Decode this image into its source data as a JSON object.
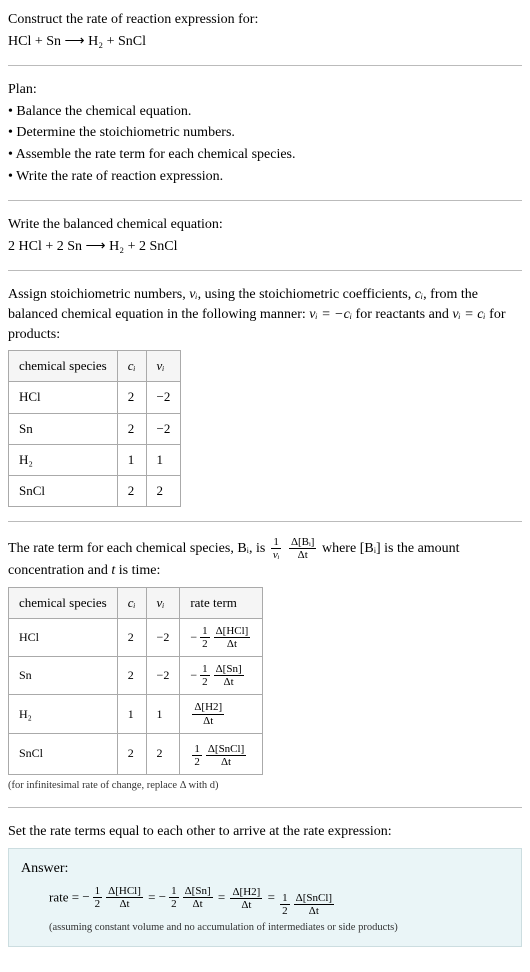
{
  "prompt": {
    "line1": "Construct the rate of reaction expression for:",
    "equation": "HCl + Sn ⟶ H₂ + SnCl"
  },
  "plan": {
    "heading": "Plan:",
    "items": [
      "• Balance the chemical equation.",
      "• Determine the stoichiometric numbers.",
      "• Assemble the rate term for each chemical species.",
      "• Write the rate of reaction expression."
    ]
  },
  "balanced": {
    "heading": "Write the balanced chemical equation:",
    "equation": "2 HCl + 2 Sn ⟶ H₂ + 2 SnCl"
  },
  "stoich": {
    "text_before": "Assign stoichiometric numbers, ",
    "nu_i": "νᵢ",
    "text_mid1": ", using the stoichiometric coefficients, ",
    "c_i": "cᵢ",
    "text_mid2": ", from the balanced chemical equation in the following manner: ",
    "eq_reactants": "νᵢ = −cᵢ",
    "text_mid3": " for reactants and ",
    "eq_products": "νᵢ = cᵢ",
    "text_after": " for products:",
    "table": {
      "headers": [
        "chemical species",
        "cᵢ",
        "νᵢ"
      ],
      "rows": [
        [
          "HCl",
          "2",
          "−2"
        ],
        [
          "Sn",
          "2",
          "−2"
        ],
        [
          "H₂",
          "1",
          "1"
        ],
        [
          "SnCl",
          "2",
          "2"
        ]
      ]
    }
  },
  "rate_term": {
    "text_before": "The rate term for each chemical species, ",
    "B_i": "Bᵢ",
    "text_mid1": ", is ",
    "frac1_num": "1",
    "frac1_den": "νᵢ",
    "frac2_num": "Δ[Bᵢ]",
    "frac2_den": "Δt",
    "text_mid2": " where ",
    "Bi_conc": "[Bᵢ]",
    "text_mid3": " is the amount concentration and ",
    "t": "t",
    "text_after": " is time:",
    "table": {
      "headers": [
        "chemical species",
        "cᵢ",
        "νᵢ",
        "rate term"
      ],
      "rows": [
        {
          "species": "HCl",
          "c": "2",
          "nu": "−2",
          "coef_num": "1",
          "coef_den": "2",
          "conc_num": "Δ[HCl]",
          "conc_den": "Δt",
          "neg": true
        },
        {
          "species": "Sn",
          "c": "2",
          "nu": "−2",
          "coef_num": "1",
          "coef_den": "2",
          "conc_num": "Δ[Sn]",
          "conc_den": "Δt",
          "neg": true
        },
        {
          "species": "H₂",
          "c": "1",
          "nu": "1",
          "coef_num": "",
          "coef_den": "",
          "conc_num": "Δ[H2]",
          "conc_den": "Δt",
          "neg": false
        },
        {
          "species": "SnCl",
          "c": "2",
          "nu": "2",
          "coef_num": "1",
          "coef_den": "2",
          "conc_num": "Δ[SnCl]",
          "conc_den": "Δt",
          "neg": false
        }
      ]
    },
    "note": "(for infinitesimal rate of change, replace Δ with d)"
  },
  "final": {
    "heading": "Set the rate terms equal to each other to arrive at the rate expression:",
    "answer_label": "Answer:",
    "rate_prefix": "rate = ",
    "terms": [
      {
        "neg": true,
        "coef_num": "1",
        "coef_den": "2",
        "conc_num": "Δ[HCl]",
        "conc_den": "Δt"
      },
      {
        "neg": true,
        "coef_num": "1",
        "coef_den": "2",
        "conc_num": "Δ[Sn]",
        "conc_den": "Δt"
      },
      {
        "neg": false,
        "coef_num": "",
        "coef_den": "",
        "conc_num": "Δ[H2]",
        "conc_den": "Δt"
      },
      {
        "neg": false,
        "coef_num": "1",
        "coef_den": "2",
        "conc_num": "Δ[SnCl]",
        "conc_den": "Δt"
      }
    ],
    "note": "(assuming constant volume and no accumulation of intermediates or side products)"
  }
}
